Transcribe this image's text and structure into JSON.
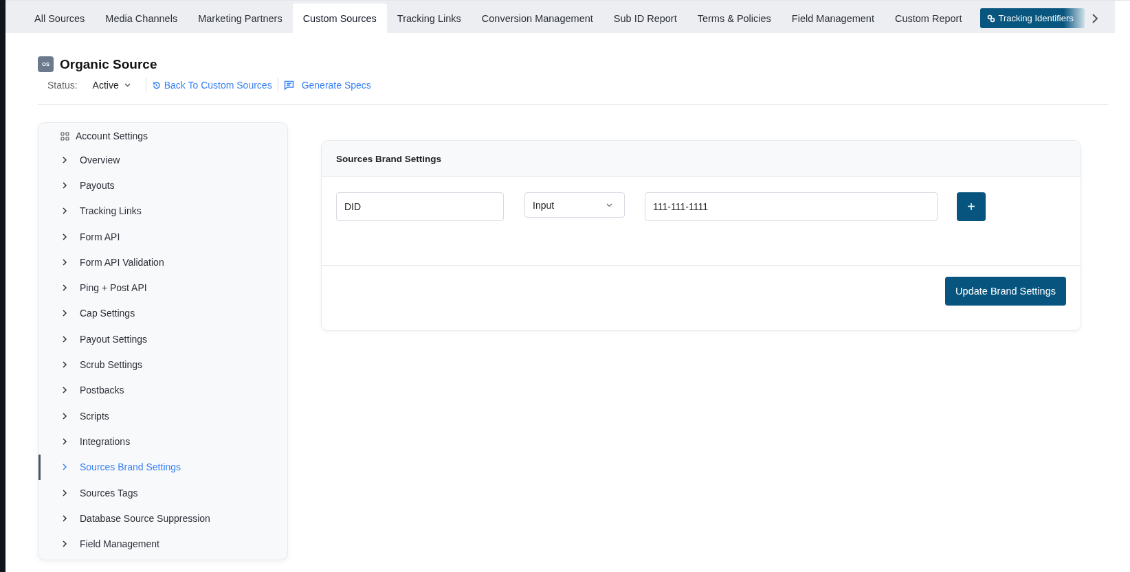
{
  "tabs": [
    {
      "label": "All Sources",
      "selected": false
    },
    {
      "label": "Media Channels",
      "selected": false
    },
    {
      "label": "Marketing Partners",
      "selected": false
    },
    {
      "label": "Custom Sources",
      "selected": true
    },
    {
      "label": "Tracking Links",
      "selected": false
    },
    {
      "label": "Conversion Management",
      "selected": false
    },
    {
      "label": "Sub ID Report",
      "selected": false
    },
    {
      "label": "Terms & Policies",
      "selected": false
    },
    {
      "label": "Field Management",
      "selected": false
    },
    {
      "label": "Custom Report",
      "selected": false
    }
  ],
  "tracking_button": {
    "label": "Tracking Identifiers"
  },
  "header": {
    "badge": "OS",
    "title": "Organic Source",
    "status_label": "Status:",
    "status_value": "Active",
    "links": [
      {
        "kind": "back",
        "label": "Back To Custom Sources"
      },
      {
        "kind": "specs",
        "label": "Generate Specs"
      }
    ]
  },
  "sidebar": {
    "section": "Account Settings",
    "items": [
      {
        "label": "Overview",
        "selected": false
      },
      {
        "label": "Payouts",
        "selected": false
      },
      {
        "label": "Tracking Links",
        "selected": false
      },
      {
        "label": "Form API",
        "selected": false
      },
      {
        "label": "Form API Validation",
        "selected": false
      },
      {
        "label": "Ping + Post API",
        "selected": false
      },
      {
        "label": "Cap Settings",
        "selected": false
      },
      {
        "label": "Payout Settings",
        "selected": false
      },
      {
        "label": "Scrub Settings",
        "selected": false
      },
      {
        "label": "Postbacks",
        "selected": false
      },
      {
        "label": "Scripts",
        "selected": false
      },
      {
        "label": "Integrations",
        "selected": false
      },
      {
        "label": "Sources Brand Settings",
        "selected": true
      },
      {
        "label": "Sources Tags",
        "selected": false
      },
      {
        "label": "Database Source Suppression",
        "selected": false
      },
      {
        "label": "Field Management",
        "selected": false
      }
    ]
  },
  "card": {
    "title": "Sources Brand Settings",
    "name_value": "DID",
    "type_value": "Input",
    "field_value": "111-111-1111",
    "add_button": "+",
    "submit_button": "Update Brand Settings"
  }
}
